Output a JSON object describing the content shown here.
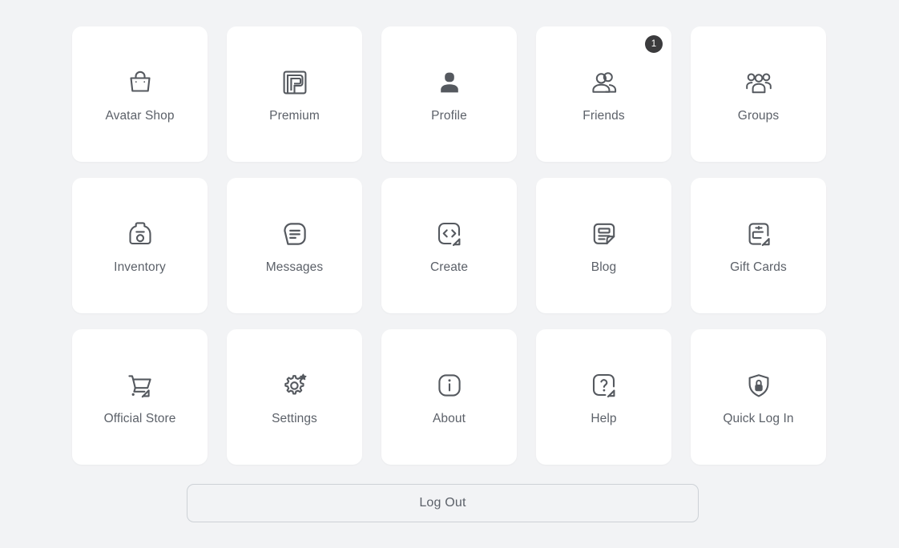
{
  "theme": {
    "background": "#f2f3f5",
    "card_background": "#ffffff",
    "label_color": "#5c6169",
    "icon_color": "#55595f",
    "badge_background": "#3b3b3d",
    "badge_text_color": "#ffffff",
    "button_border_color": "#cdd1d6"
  },
  "menu": {
    "items": [
      {
        "label": "Avatar Shop",
        "icon": "shopping-bag-icon",
        "badge": null
      },
      {
        "label": "Premium",
        "icon": "premium-spiral-icon",
        "badge": null
      },
      {
        "label": "Profile",
        "icon": "person-filled-icon",
        "badge": null
      },
      {
        "label": "Friends",
        "icon": "two-people-icon",
        "badge": "1"
      },
      {
        "label": "Groups",
        "icon": "three-people-icon",
        "badge": null
      },
      {
        "label": "Inventory",
        "icon": "backpack-icon",
        "badge": null
      },
      {
        "label": "Messages",
        "icon": "message-bubble-icon",
        "badge": null
      },
      {
        "label": "Create",
        "icon": "code-brackets-arrow-icon",
        "badge": null
      },
      {
        "label": "Blog",
        "icon": "document-folded-icon",
        "badge": null
      },
      {
        "label": "Gift Cards",
        "icon": "gift-card-arrow-icon",
        "badge": null
      },
      {
        "label": "Official Store",
        "icon": "shopping-cart-arrow-icon",
        "badge": null
      },
      {
        "label": "Settings",
        "icon": "gear-sparkle-icon",
        "badge": null
      },
      {
        "label": "About",
        "icon": "info-square-icon",
        "badge": null
      },
      {
        "label": "Help",
        "icon": "question-mark-arrow-icon",
        "badge": null
      },
      {
        "label": "Quick Log In",
        "icon": "shield-lock-icon",
        "badge": null
      }
    ]
  },
  "footer": {
    "logout_label": "Log Out"
  }
}
